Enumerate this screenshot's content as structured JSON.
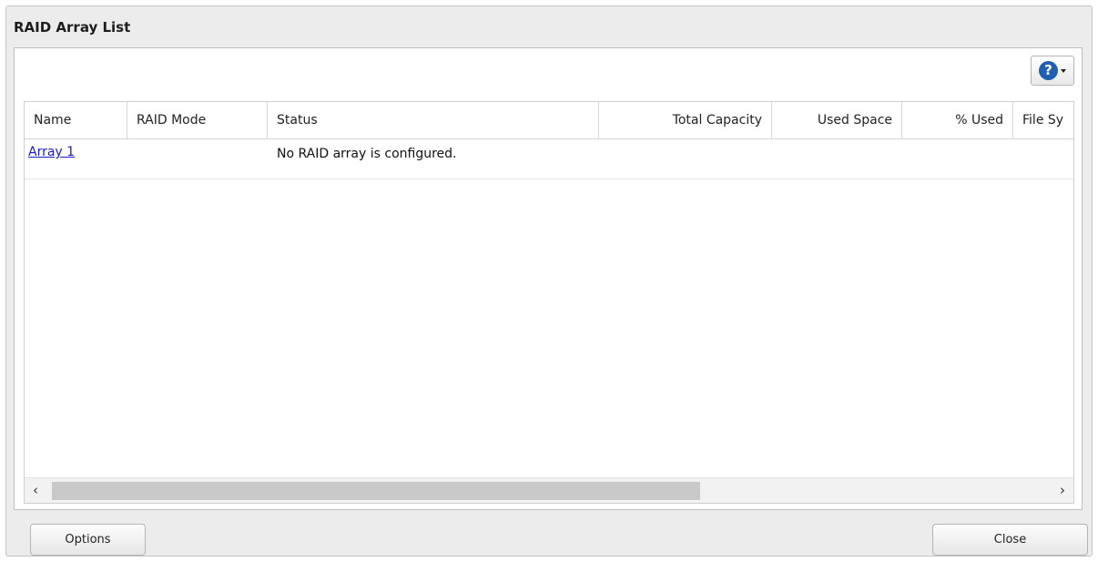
{
  "window": {
    "title": "RAID Array List"
  },
  "toolbar": {
    "help_icon_glyph": "?"
  },
  "table": {
    "columns": [
      "Name",
      "RAID Mode",
      "Status",
      "Total Capacity",
      "Used Space",
      "% Used",
      "File Sy"
    ],
    "rows": [
      {
        "name": "Array 1",
        "raid_mode": "",
        "status": "No RAID array is configured.",
        "total_capacity": "",
        "used_space": "",
        "percent_used": "",
        "file_system": ""
      }
    ]
  },
  "scrollbar": {
    "left_arrow": "‹",
    "right_arrow": "›"
  },
  "buttons": {
    "options": "Options",
    "close": "Close"
  },
  "colors": {
    "link": "#1a1ad6",
    "help_icon": "#1f5fb2"
  }
}
